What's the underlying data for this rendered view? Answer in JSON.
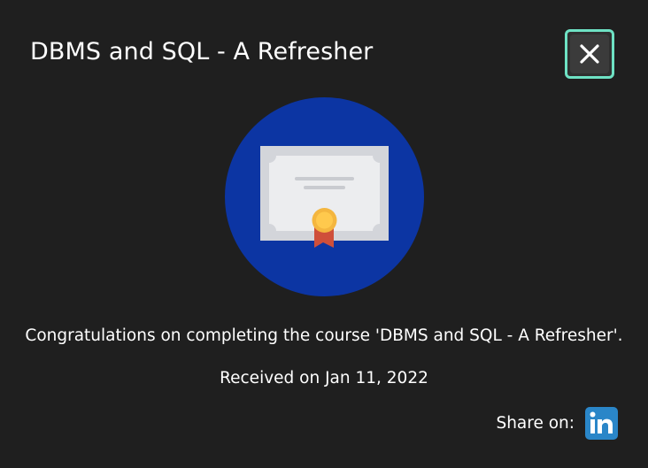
{
  "dialog": {
    "title": "DBMS and SQL - A Refresher",
    "close_icon": "close-icon",
    "badge_icon": "certificate-icon",
    "message": "Congratulations on completing the course 'DBMS and SQL - A Refresher'.",
    "received": "Received on Jan 11, 2022",
    "share_label": "Share on:",
    "share_icon": "linkedin-icon"
  },
  "colors": {
    "background": "#1f1f1f",
    "focus_ring": "#6ee2c4",
    "badge_circle": "#0c35a3",
    "linkedin": "#2a86c8"
  }
}
